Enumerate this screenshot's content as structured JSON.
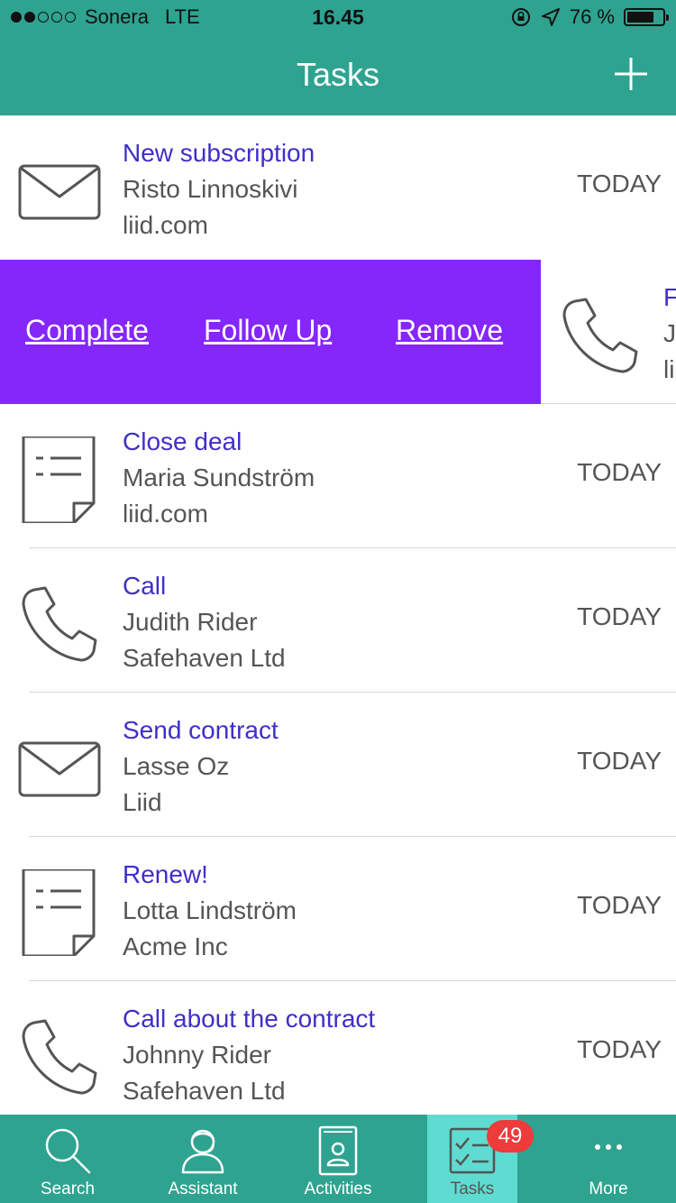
{
  "status_bar": {
    "carrier": "Sonera",
    "network": "LTE",
    "time": "16.45",
    "battery": "76 %",
    "battery_level": 0.76
  },
  "header": {
    "title": "Tasks",
    "add_icon": "plus-icon"
  },
  "swipe_actions": {
    "complete": "Complete",
    "follow_up": "Follow Up",
    "remove": "Remove"
  },
  "tasks": [
    {
      "icon": "envelope-icon",
      "title": "New subscription",
      "person": "Risto Linnoskivi",
      "company": "liid.com",
      "date": "TODAY"
    },
    {
      "icon": "phone-icon",
      "title": "F",
      "person": "J",
      "company": "li",
      "date": ""
    },
    {
      "icon": "document-icon",
      "title": "Close deal",
      "person": "Maria Sundström",
      "company": "liid.com",
      "date": "TODAY"
    },
    {
      "icon": "phone-icon",
      "title": "Call",
      "person": "Judith Rider",
      "company": "Safehaven Ltd",
      "date": "TODAY"
    },
    {
      "icon": "envelope-icon",
      "title": "Send contract",
      "person": "Lasse Oz",
      "company": "Liid",
      "date": "TODAY"
    },
    {
      "icon": "document-icon",
      "title": "Renew!",
      "person": "Lotta Lindström",
      "company": "Acme Inc",
      "date": "TODAY"
    },
    {
      "icon": "phone-icon",
      "title": "Call about the contract",
      "person": "Johnny Rider",
      "company": "Safehaven Ltd",
      "date": "TODAY"
    }
  ],
  "tabbar": {
    "items": [
      {
        "label": "Search",
        "icon": "search-icon"
      },
      {
        "label": "Assistant",
        "icon": "assistant-icon"
      },
      {
        "label": "Activities",
        "icon": "activities-icon"
      },
      {
        "label": "Tasks",
        "icon": "tasks-icon",
        "badge": "49"
      },
      {
        "label": "More",
        "icon": "more-icon"
      }
    ]
  },
  "colors": {
    "brand": "#2ea390",
    "active_tab": "#5fdcd1",
    "swipe_bg": "#8526fb",
    "title_text": "#3f2fc9",
    "badge": "#ee3b3b"
  }
}
